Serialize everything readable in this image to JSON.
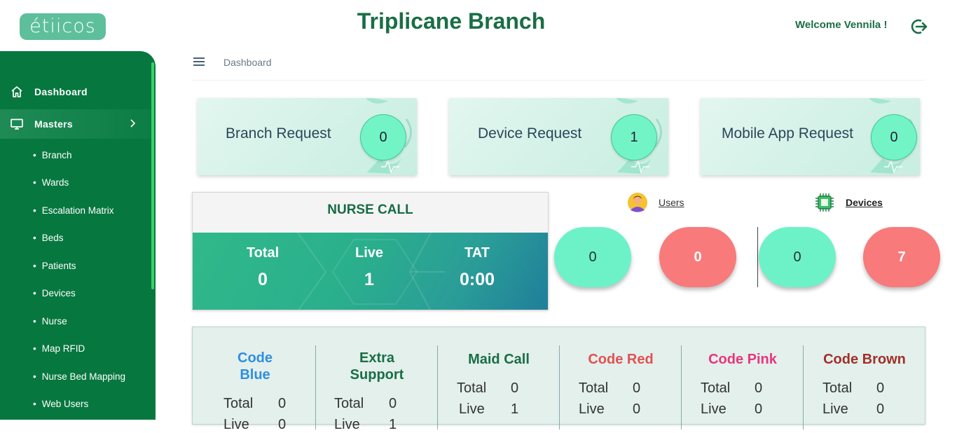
{
  "header": {
    "logo": "étiicos",
    "title": "Triplicane Branch",
    "welcome": "Welcome Vennila !"
  },
  "sidebar": {
    "items": [
      {
        "label": "Dashboard",
        "icon": "home-icon"
      },
      {
        "label": "Masters",
        "icon": "monitor-icon"
      }
    ],
    "sub_items": [
      "Branch",
      "Wards",
      "Escalation Matrix",
      "Beds",
      "Patients",
      "Devices",
      "Nurse",
      "Map RFID",
      "Nurse Bed Mapping",
      "Web Users"
    ]
  },
  "breadcrumb": "Dashboard",
  "requests": [
    {
      "label": "Branch Request",
      "count": "0"
    },
    {
      "label": "Device Request",
      "count": "1"
    },
    {
      "label": "Mobile App Request",
      "count": "0"
    }
  ],
  "nurse_call": {
    "title": "NURSE CALL",
    "stats": [
      {
        "label": "Total",
        "value": "0"
      },
      {
        "label": "Live",
        "value": "1"
      },
      {
        "label": "TAT",
        "value": "0:00"
      }
    ]
  },
  "users": {
    "label": "Users",
    "values": [
      "0",
      "0"
    ]
  },
  "devices": {
    "label": "Devices",
    "values": [
      "0",
      "7"
    ]
  },
  "codes": [
    {
      "title": "Code Blue",
      "color": "#2f8fe0",
      "total": "0",
      "live": "0"
    },
    {
      "title": "Extra Support",
      "color": "#1a6e45",
      "total": "0",
      "live": "1"
    },
    {
      "title": "Maid Call",
      "color": "#1a6e45",
      "total": "0",
      "live": "1"
    },
    {
      "title": "Code Red",
      "color": "#e05252",
      "total": "0",
      "live": "0"
    },
    {
      "title": "Code Pink",
      "color": "#e8357f",
      "total": "0",
      "live": "0"
    },
    {
      "title": "Code Brown",
      "color": "#a0302a",
      "total": "0",
      "live": "0"
    }
  ],
  "labels": {
    "total": "Total",
    "live": "Live"
  },
  "colors": {
    "primary": "#06773f",
    "accent_green": "#6df2c7",
    "alert_red": "#f87a7a"
  }
}
